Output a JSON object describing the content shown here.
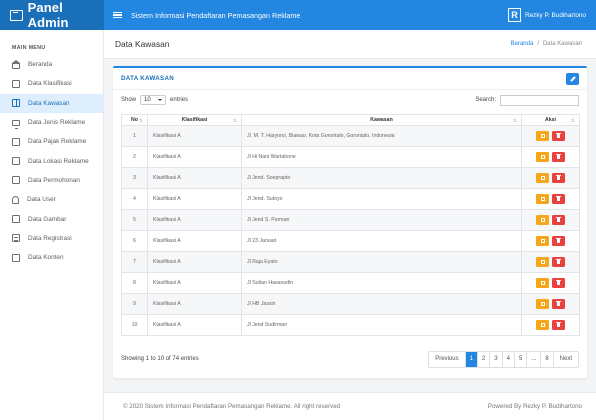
{
  "brand": {
    "title": "Panel Admin",
    "icon": "panel-icon"
  },
  "topbar": {
    "app_title": "Sistem Informasi Pendaftaran Pemasangan Reklame",
    "user_logo": "R",
    "user_name": "Rezky P. Budihartono"
  },
  "sidebar": {
    "heading": "MAIN MENU",
    "items": [
      {
        "label": "Beranda",
        "icon": "home-icon"
      },
      {
        "label": "Data Klasifikasi",
        "icon": "folder-icon"
      },
      {
        "label": "Data Kawasan",
        "icon": "book-icon",
        "active": true
      },
      {
        "label": "Data Jenis Reklame",
        "icon": "monitor-icon"
      },
      {
        "label": "Data Pajak Reklame",
        "icon": "calendar-icon"
      },
      {
        "label": "Data Lokasi Reklame",
        "icon": "layers-icon"
      },
      {
        "label": "Data Permohonan",
        "icon": "document-icon"
      },
      {
        "label": "Data User",
        "icon": "user-icon"
      },
      {
        "label": "Data Gambar",
        "icon": "image-icon"
      },
      {
        "label": "Data Registrasi",
        "icon": "list-icon"
      },
      {
        "label": "Data Konten",
        "icon": "columns-icon"
      }
    ]
  },
  "header": {
    "title": "Data Kawasan",
    "breadcrumb": [
      "Beranda",
      "/",
      "Data Kawasan"
    ]
  },
  "card": {
    "title": "DATA KAWASAN",
    "edit_icon": "pencil-icon"
  },
  "controls": {
    "show_label": "Show",
    "show_value": "10",
    "entries_label": "entries",
    "search_label": "Search:",
    "search_value": ""
  },
  "table": {
    "columns": [
      "No",
      "Klasifikasi",
      "Kawasan",
      "Aksi"
    ],
    "rows": [
      {
        "no": "1",
        "klasifikasi": "Klasifikasi A",
        "kawasan": "Jl. M. T. Haryono, Biawao, Kota Gorontalo, Gorontalo, Indonesia"
      },
      {
        "no": "2",
        "klasifikasi": "Klasifikasi A",
        "kawasan": "Jl Hi Nani Wartabone"
      },
      {
        "no": "3",
        "klasifikasi": "Klasifikasi A",
        "kawasan": "Jl Jend. Soeprapto"
      },
      {
        "no": "4",
        "klasifikasi": "Klasifikasi A",
        "kawasan": "Jl Jend. Sutoyo"
      },
      {
        "no": "5",
        "klasifikasi": "Klasifikasi A",
        "kawasan": "Jl Jend S. Parman"
      },
      {
        "no": "6",
        "klasifikasi": "Klasifikasi A",
        "kawasan": "Jl 23 Januari"
      },
      {
        "no": "7",
        "klasifikasi": "Klasifikasi A",
        "kawasan": "Jl Raja Eyato"
      },
      {
        "no": "8",
        "klasifikasi": "Klasifikasi A",
        "kawasan": "Jl Sultan Hasanudin"
      },
      {
        "no": "9",
        "klasifikasi": "Klasifikasi A",
        "kawasan": "Jl HB Jassin"
      },
      {
        "no": "10",
        "klasifikasi": "Klasifikasi A",
        "kawasan": "Jl Jend Sudirman"
      }
    ]
  },
  "info": {
    "text": "Showing 1 to 10 of 74 entries"
  },
  "pagination": {
    "previous": "Previous",
    "pages": [
      "1",
      "2",
      "3",
      "4",
      "5",
      "...",
      "8"
    ],
    "next": "Next",
    "current": "1"
  },
  "footer": {
    "left": "© 2020 Sistem Informasi Pendaftaran Pemasangan Reklame. All right reserved",
    "right": "Powered By Rezky P. Budihartono"
  },
  "colors": {
    "brand": "#1a6fb9",
    "topbar": "#2386e0",
    "edit": "#f5a61a",
    "delete": "#e8413e"
  }
}
